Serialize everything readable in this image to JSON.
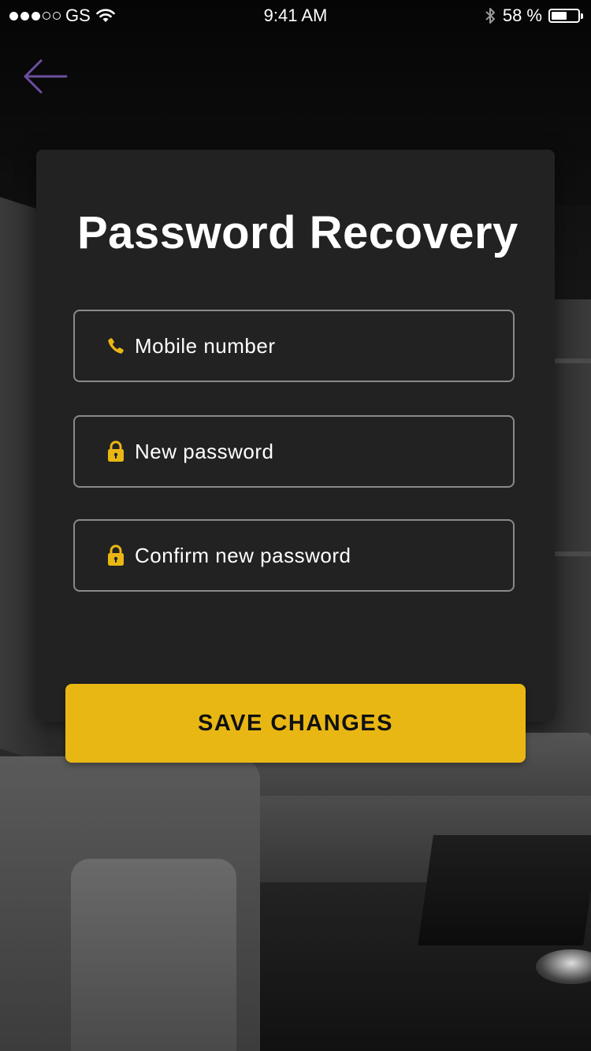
{
  "status_bar": {
    "carrier": "GS",
    "time": "9:41 AM",
    "battery_percent": "58 %",
    "battery_level": 0.58,
    "signal_bars_filled": 3,
    "signal_bars_total": 5
  },
  "nav": {
    "back_icon": "arrow-left-icon",
    "back_color": "#6b4fa0"
  },
  "card": {
    "title": "Password Recovery"
  },
  "form": {
    "mobile": {
      "icon": "phone-icon",
      "placeholder": "Mobile number",
      "value": ""
    },
    "new_password": {
      "icon": "lock-icon",
      "placeholder": "New password",
      "value": ""
    },
    "confirm_password": {
      "icon": "lock-icon",
      "placeholder": "Confirm new password",
      "value": ""
    }
  },
  "actions": {
    "save_label": "SAVE CHANGES"
  },
  "colors": {
    "accent": "#e9b714",
    "card_bg": "#222222",
    "field_border": "#8a8a8a",
    "back_arrow": "#6b4fa0"
  }
}
